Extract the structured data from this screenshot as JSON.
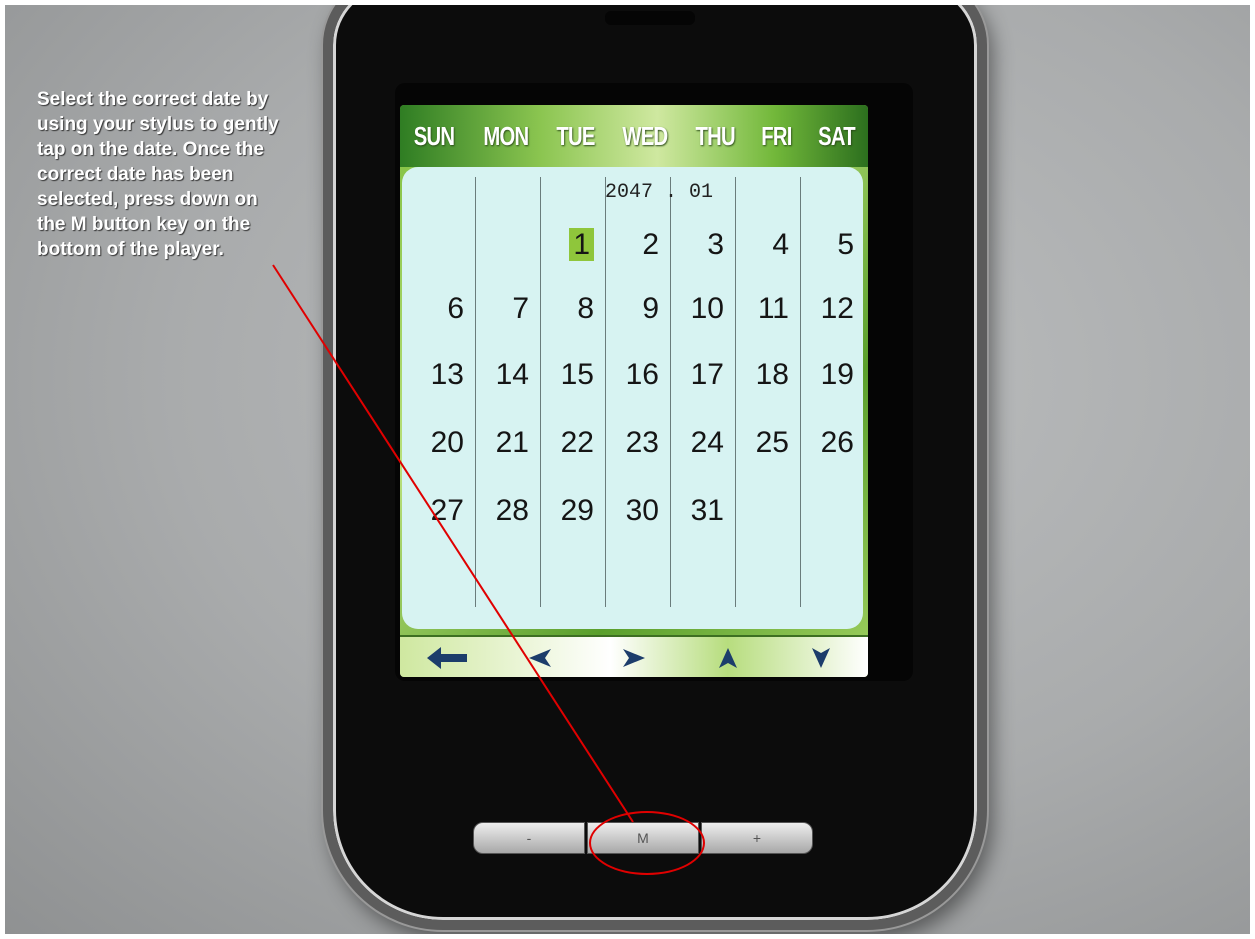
{
  "instruction": {
    "lines": [
      "Select the correct date by",
      "using your stylus to gently",
      "tap on the date. Once the",
      "correct date has been",
      "selected, press down on",
      "the M button key on the",
      "bottom of the player."
    ]
  },
  "calendar": {
    "weekdays": [
      "SUN",
      "MON",
      "TUE",
      "WED",
      "THU",
      "FRI",
      "SAT"
    ],
    "year_month": "2047 . 01",
    "selected_day": "1",
    "weeks": [
      [
        "",
        "",
        "1",
        "2",
        "3",
        "4",
        "5"
      ],
      [
        "6",
        "7",
        "8",
        "9",
        "10",
        "11",
        "12"
      ],
      [
        "13",
        "14",
        "15",
        "16",
        "17",
        "18",
        "19"
      ],
      [
        "20",
        "21",
        "22",
        "23",
        "24",
        "25",
        "26"
      ],
      [
        "27",
        "28",
        "29",
        "30",
        "31",
        "",
        ""
      ]
    ]
  },
  "toolbar": {
    "back_icon": "back-arrow-icon",
    "left_icon": "left-triangle-icon",
    "right_icon": "right-triangle-icon",
    "up_icon": "up-triangle-icon",
    "down_icon": "down-triangle-icon"
  },
  "hardware_buttons": {
    "minus_label": "-",
    "m_label": "M",
    "plus_label": "+"
  },
  "colors": {
    "annotation": "#e00000",
    "selected_day": "#8fc63b",
    "calendar_bg": "#d7f3f2"
  }
}
